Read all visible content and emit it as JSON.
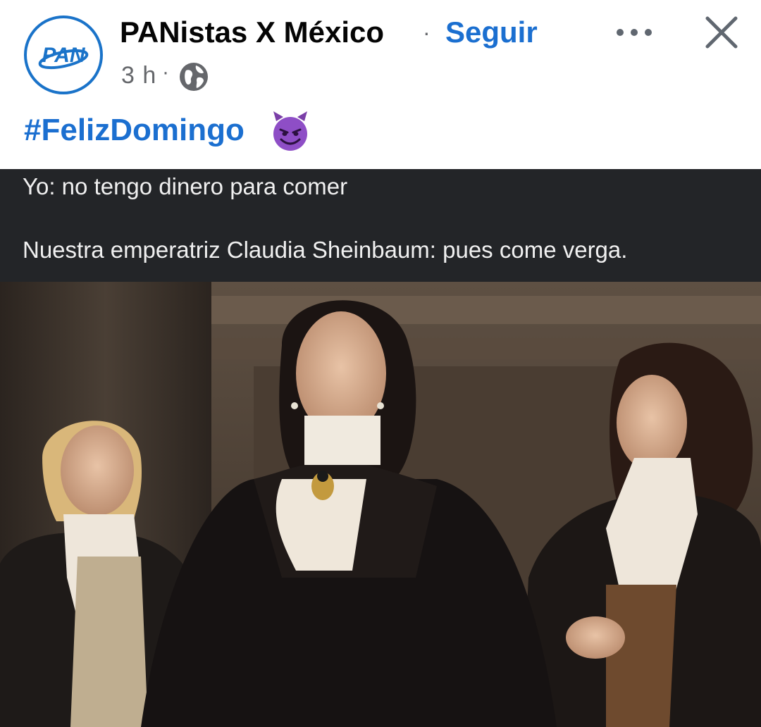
{
  "post": {
    "page_name": "PANistas X México",
    "separator": "·",
    "follow_label": "Seguir",
    "time": "3 h",
    "time_separator": "·",
    "privacy_icon": "globe-icon",
    "hashtag": "#FelizDomingo",
    "emoji": "smiling-imp-emoji"
  },
  "avatar": {
    "logo_text": "PAN",
    "brand_color": "#1a73c9"
  },
  "actions": {
    "more_icon": "more-horizontal-icon",
    "close_icon": "close-icon"
  },
  "meme": {
    "caption_line1": "Yo: no tengo dinero para comer",
    "caption_line2": "Nuestra emperatriz Claudia Sheinbaum: pues come verga.",
    "caption_bg": "#232528",
    "photo": "three people in dark Victorian period costumes with white lace cravats in an ornate hall"
  },
  "colors": {
    "link_blue": "#1b6fd0",
    "secondary_text": "#65676b"
  }
}
